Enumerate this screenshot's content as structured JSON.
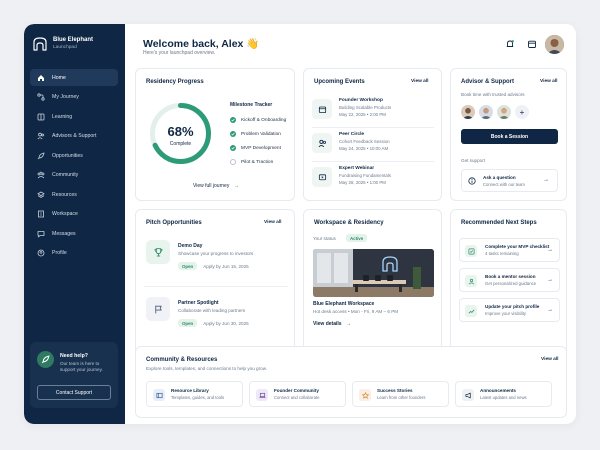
{
  "brand": {
    "name": "Blue Elephant",
    "sub": "Launchpad"
  },
  "nav": [
    {
      "label": "Home",
      "icon": "home-icon",
      "active": true
    },
    {
      "label": "My Journey",
      "icon": "journey-icon"
    },
    {
      "label": "Learning",
      "icon": "book-icon"
    },
    {
      "label": "Advisors & Support",
      "icon": "people-icon"
    },
    {
      "label": "Opportunities",
      "icon": "rocket-icon"
    },
    {
      "label": "Community",
      "icon": "community-icon"
    },
    {
      "label": "Resources",
      "icon": "layers-icon"
    },
    {
      "label": "Workspace",
      "icon": "building-icon"
    },
    {
      "label": "Messages",
      "icon": "chat-icon"
    },
    {
      "label": "Profile",
      "icon": "user-icon"
    }
  ],
  "help": {
    "title": "Need help?",
    "text": "Our team is here to support your journey.",
    "button": "Contact Support"
  },
  "header": {
    "title": "Welcome back, Alex",
    "emoji": "👋",
    "subtitle": "Here's your launchpad overview."
  },
  "residency": {
    "title": "Residency Progress",
    "progress": 68,
    "progress_label": "68%",
    "complete_label": "Complete",
    "milestone_title": "Milestone Tracker",
    "milestones": [
      {
        "label": "Kickoff & Onboarding",
        "done": true
      },
      {
        "label": "Problem Validation",
        "done": true
      },
      {
        "label": "MVP Development",
        "done": true
      },
      {
        "label": "Pilot & Traction",
        "done": false
      }
    ],
    "link": "View full journey",
    "accent": "#2d9b78",
    "track": "#e3efea"
  },
  "events": {
    "title": "Upcoming Events",
    "view_all": "View all",
    "items": [
      {
        "title": "Founder Workshop",
        "subtitle": "Building Scalable Products",
        "time": "May 22, 2025 • 2:00 PM",
        "icon": "calendar-icon"
      },
      {
        "title": "Peer Circle",
        "subtitle": "Cohort Feedback Session",
        "time": "May 24, 2025 • 10:00 AM",
        "icon": "people-icon"
      },
      {
        "title": "Expert Webinar",
        "subtitle": "Fundraising Fundamentals",
        "time": "May 28, 2025 • 1:00 PM",
        "icon": "video-icon"
      }
    ]
  },
  "advisors": {
    "title": "Advisor & Support",
    "view_all": "View all",
    "subtitle": "Book time with trusted advisors",
    "button": "Book a Session",
    "get_support": "Get support",
    "question_title": "Ask a question",
    "question_sub": "Connect with our team"
  },
  "pitch": {
    "title": "Pitch Opportunities",
    "view_all": "View all",
    "items": [
      {
        "title": "Demo Day",
        "subtitle": "Showcase your progress to investors",
        "status": "Open",
        "deadline": "Apply by Jun 15, 2025",
        "icon": "trophy-icon"
      },
      {
        "title": "Partner Spotlight",
        "subtitle": "Collaborate with leading partners",
        "status": "Open",
        "deadline": "Apply by Jun 30, 2025",
        "icon": "flag-icon"
      }
    ]
  },
  "workspace": {
    "title": "Workspace & Residency",
    "status_label": "Your status",
    "status": "Active",
    "name": "Blue Elephant Workspace",
    "details": "Hot desk access • Mon - Fri, 9 AM – 6 PM",
    "link": "View details"
  },
  "next_steps": {
    "title": "Recommended Next Steps",
    "items": [
      {
        "title": "Complete your MVP checklist",
        "subtitle": "4 tasks remaining",
        "icon": "checklist-icon"
      },
      {
        "title": "Book a mentor session",
        "subtitle": "Get personalized guidance",
        "icon": "mentor-icon"
      },
      {
        "title": "Update your pitch profile",
        "subtitle": "Improve your visibility",
        "icon": "chart-icon"
      }
    ]
  },
  "community": {
    "title": "Community & Resources",
    "subtitle": "Explore tools, templates, and connections to help you grow.",
    "view_all": "View all",
    "items": [
      {
        "title": "Resource Library",
        "subtitle": "Templates, guides, and tools",
        "icon": "library-icon",
        "color": "#e8eef8"
      },
      {
        "title": "Founder Community",
        "subtitle": "Connect and collaborate",
        "icon": "laptop-icon",
        "color": "#efe9f7"
      },
      {
        "title": "Success Stories",
        "subtitle": "Learn from other founders",
        "icon": "star-icon",
        "color": "#fbefe2"
      },
      {
        "title": "Announcements",
        "subtitle": "Latest updates and news",
        "icon": "megaphone-icon",
        "color": "#eef0f3"
      }
    ]
  }
}
